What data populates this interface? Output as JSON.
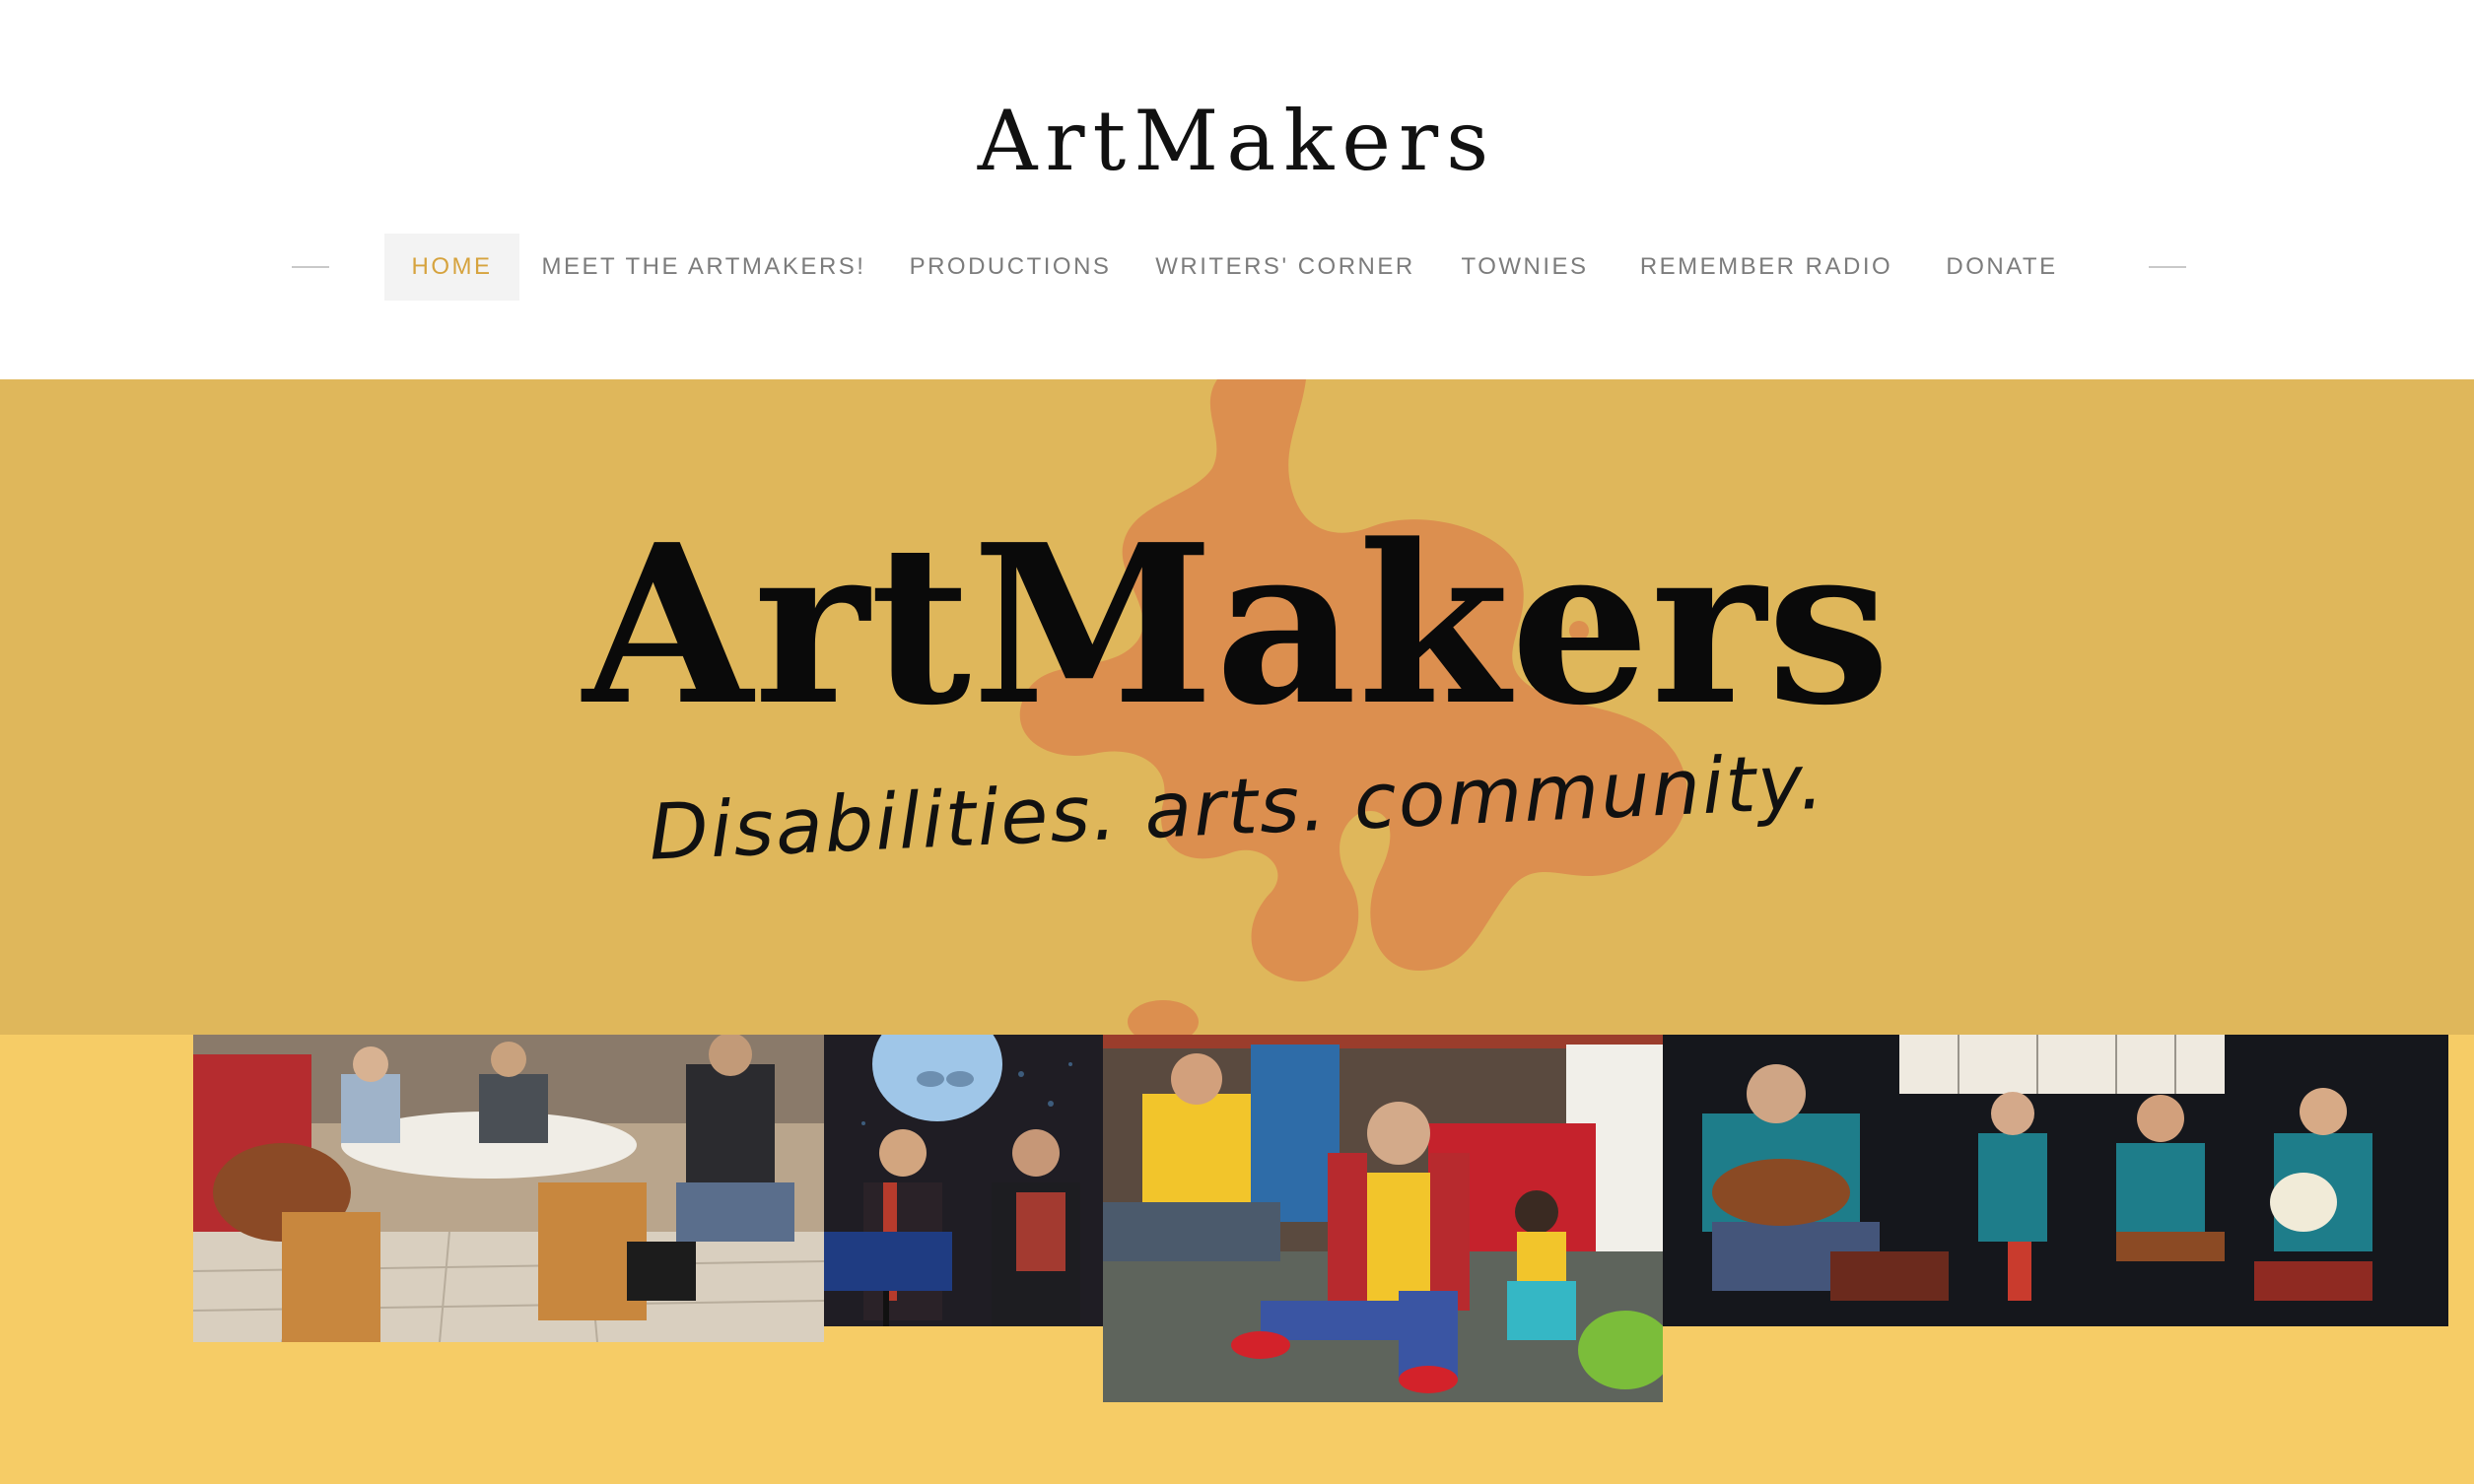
{
  "header": {
    "site_title": "ArtMakers"
  },
  "nav": {
    "items": [
      {
        "label": "HOME",
        "active": true
      },
      {
        "label": "MEET THE ARTMAKERS!",
        "active": false
      },
      {
        "label": "PRODUCTIONS",
        "active": false
      },
      {
        "label": "WRITERS' CORNER",
        "active": false
      },
      {
        "label": "TOWNIES",
        "active": false
      },
      {
        "label": "REMEMBER RADIO",
        "active": false
      },
      {
        "label": "DONATE",
        "active": false
      }
    ]
  },
  "hero": {
    "title": "ArtMakers",
    "tagline": "Disabilities. arts. community.",
    "background_color": "#dfb75b",
    "splat_color": "#dc8f4f"
  },
  "gallery": {
    "background_color": "#f6cc66",
    "photos": [
      {
        "name": "musicians-at-table-photo"
      },
      {
        "name": "performers-under-moon-photo"
      },
      {
        "name": "performer-sitting-on-floor-photo"
      },
      {
        "name": "band-on-stage-photo"
      }
    ]
  },
  "colors": {
    "accent": "#d6a33e",
    "nav_text": "#7c7c7c",
    "active_tab_bg": "#f3f3f3"
  }
}
